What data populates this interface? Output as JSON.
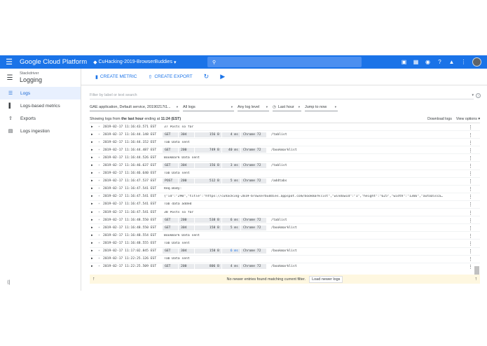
{
  "topbar": {
    "brand": "Google Cloud Platform",
    "project": "CuHacking-2019-BrowserBuddies",
    "icons": [
      "menu-icon",
      "search-icon",
      "gift-icon",
      "cloud-shell-icon",
      "support-icon",
      "help-icon",
      "notifications-icon",
      "more-icon"
    ]
  },
  "sidebar": {
    "product_small": "Stackdriver",
    "product": "Logging",
    "items": [
      {
        "label": "Logs",
        "icon": "list-icon",
        "active": true
      },
      {
        "label": "Logs-based metrics",
        "icon": "bar-chart-icon",
        "active": false
      },
      {
        "label": "Exports",
        "icon": "export-icon",
        "active": false
      },
      {
        "label": "Logs ingestion",
        "icon": "storage-icon",
        "active": false
      }
    ]
  },
  "toolbar": {
    "create_metric": "CREATE METRIC",
    "create_export": "CREATE EXPORT"
  },
  "filter": {
    "placeholder": "Filter by label or text search"
  },
  "selectors": {
    "resource": "GAE application, Default service, 20190217t1...",
    "logs": "All logs",
    "level": "Any log level",
    "time": "Last hour",
    "jump": "Jump to now"
  },
  "info": {
    "prefix": "Showing logs from",
    "range": "the last hour",
    "suffix": "ending at",
    "time": "11:24 (EST)",
    "download": "Download logs",
    "view_options": "View options"
  },
  "logs": [
    {
      "ts": "2019-02-17 11:16:43.571 EST",
      "text": "37 Posts so far"
    },
    {
      "ts": "2019-02-17 11:16:44.148 EST",
      "method": "GET",
      "status": "304",
      "size": "156 B",
      "latency": "4 ms",
      "ua": "Chrome 72",
      "path": "/tablist"
    },
    {
      "ts": "2019-02-17 11:16:44.152 EST",
      "text": "Tab Data sent"
    },
    {
      "ts": "2019-02-17 11:16:44.487 EST",
      "method": "GET",
      "status": "200",
      "size": "749 B",
      "latency": "40 ms",
      "ua": "Chrome 72",
      "path": "/bookmarklist"
    },
    {
      "ts": "2019-02-17 11:16:44.526 EST",
      "text": "Bookmark Data sent"
    },
    {
      "ts": "2019-02-17 11:16:46.637 EST",
      "method": "GET",
      "status": "304",
      "size": "156 B",
      "latency": "3 ms",
      "ua": "Chrome 72",
      "path": "/tablist"
    },
    {
      "ts": "2019-02-17 11:16:46.640 EST",
      "text": "Tab Data sent"
    },
    {
      "ts": "2019-02-17 11:16:47.537 EST",
      "method": "POST",
      "status": "200",
      "size": "512 B",
      "latency": "5 ms",
      "ua": "Chrome 72",
      "path": "/addtabs"
    },
    {
      "ts": "2019-02-17 11:16:47.541 EST",
      "text": "Req.Body:"
    },
    {
      "ts": "2019-02-17 11:16:47.541 EST",
      "text": "{\"id\":\"290\",\"title\":\"https://cuhacking-2019-browserbuddies.appspot.com/bookmarklist\",\"windowId\":\"1\",\"height\":\"625\",\"width\":\"1366\",\"autoDisca…"
    },
    {
      "ts": "2019-02-17 11:16:47.541 EST",
      "text": "Tab data added"
    },
    {
      "ts": "2019-02-17 11:16:47.541 EST",
      "text": "38 Posts so far"
    },
    {
      "ts": "2019-02-17 11:16:48.550 EST",
      "method": "GET",
      "status": "200",
      "size": "538 B",
      "latency": "6 ms",
      "ua": "Chrome 72",
      "path": "/tablist"
    },
    {
      "ts": "2019-02-17 11:16:48.550 EST",
      "method": "GET",
      "status": "304",
      "size": "158 B",
      "latency": "5 ms",
      "ua": "Chrome 72",
      "path": "/bookmarklist"
    },
    {
      "ts": "2019-02-17 11:16:48.554 EST",
      "text": "Bookmark Data sent"
    },
    {
      "ts": "2019-02-17 11:16:48.555 EST",
      "text": "Tab Data sent"
    },
    {
      "ts": "2019-02-17 11:17:02.845 EST",
      "method": "GET",
      "status": "304",
      "size": "158 B",
      "latency": "6 ms",
      "latency_blue": true,
      "ua": "Chrome 72",
      "path": "/bookmarklist"
    },
    {
      "ts": "2019-02-17 11:22:25.126 EST",
      "text": "Tab Data sent"
    },
    {
      "ts": "2019-02-17 11:22:25.509 EST",
      "method": "GET",
      "status": "200",
      "size": "806 B",
      "latency": "4 ms",
      "ua": "Chrome 72",
      "path": "/bookmarklist"
    },
    {
      "ts": "2019-02-17 11:22:25.514 EST",
      "text": "Bookmark Data sent"
    }
  ],
  "footer": {
    "message": "No newer entries found matching current filter.",
    "button": "Load newer logs"
  },
  "colors": {
    "topbar": "#1a73e8",
    "accent": "#1a73e8",
    "footer": "#fef7e0"
  }
}
